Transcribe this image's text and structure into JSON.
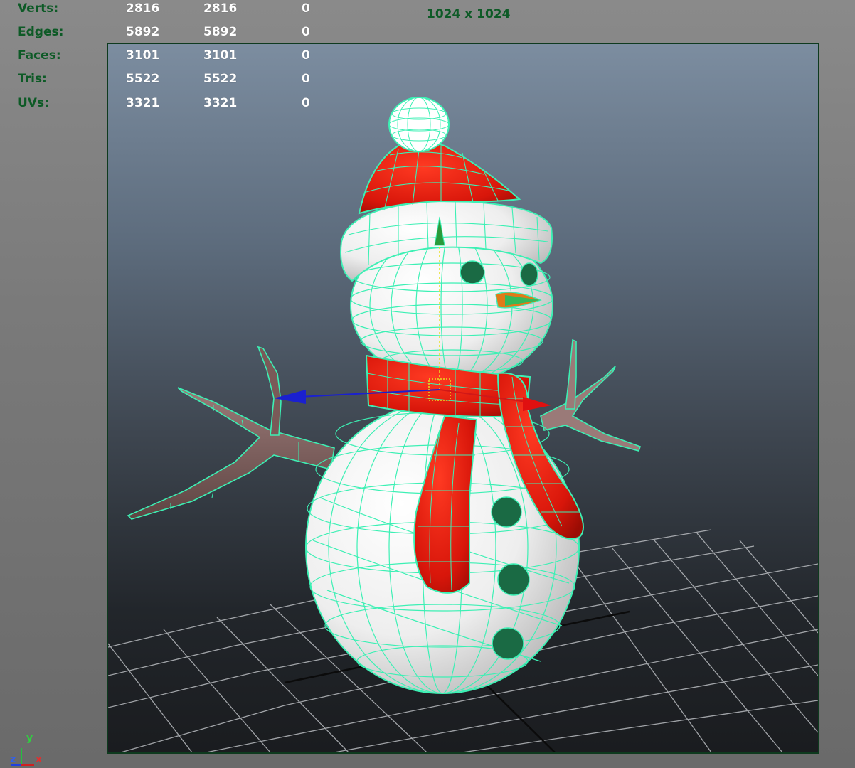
{
  "stats": {
    "rows": [
      {
        "label": "Verts:",
        "v1": "2816",
        "v2": "2816",
        "v3": "0"
      },
      {
        "label": "Edges:",
        "v1": "5892",
        "v2": "5892",
        "v3": "0"
      },
      {
        "label": "Faces:",
        "v1": "3101",
        "v2": "3101",
        "v3": "0"
      },
      {
        "label": "Tris:",
        "v1": "5522",
        "v2": "5522",
        "v3": "0"
      },
      {
        "label": "UVs:",
        "v1": "3321",
        "v2": "3321",
        "v3": "0"
      }
    ]
  },
  "viewport": {
    "resolution": "1024 x 1024"
  },
  "axis_gizmo": {
    "y": "y",
    "z": "z",
    "x": "x"
  },
  "colors": {
    "wireframe": "#3cf0b4",
    "hat_red": "#d8160a",
    "scarf_red": "#e01a0c",
    "body_white": "#f4f4f4",
    "branch_brown": "#7a5a58",
    "hud_label_green": "#0d5a26",
    "viewport_border": "#0e3a1e"
  }
}
